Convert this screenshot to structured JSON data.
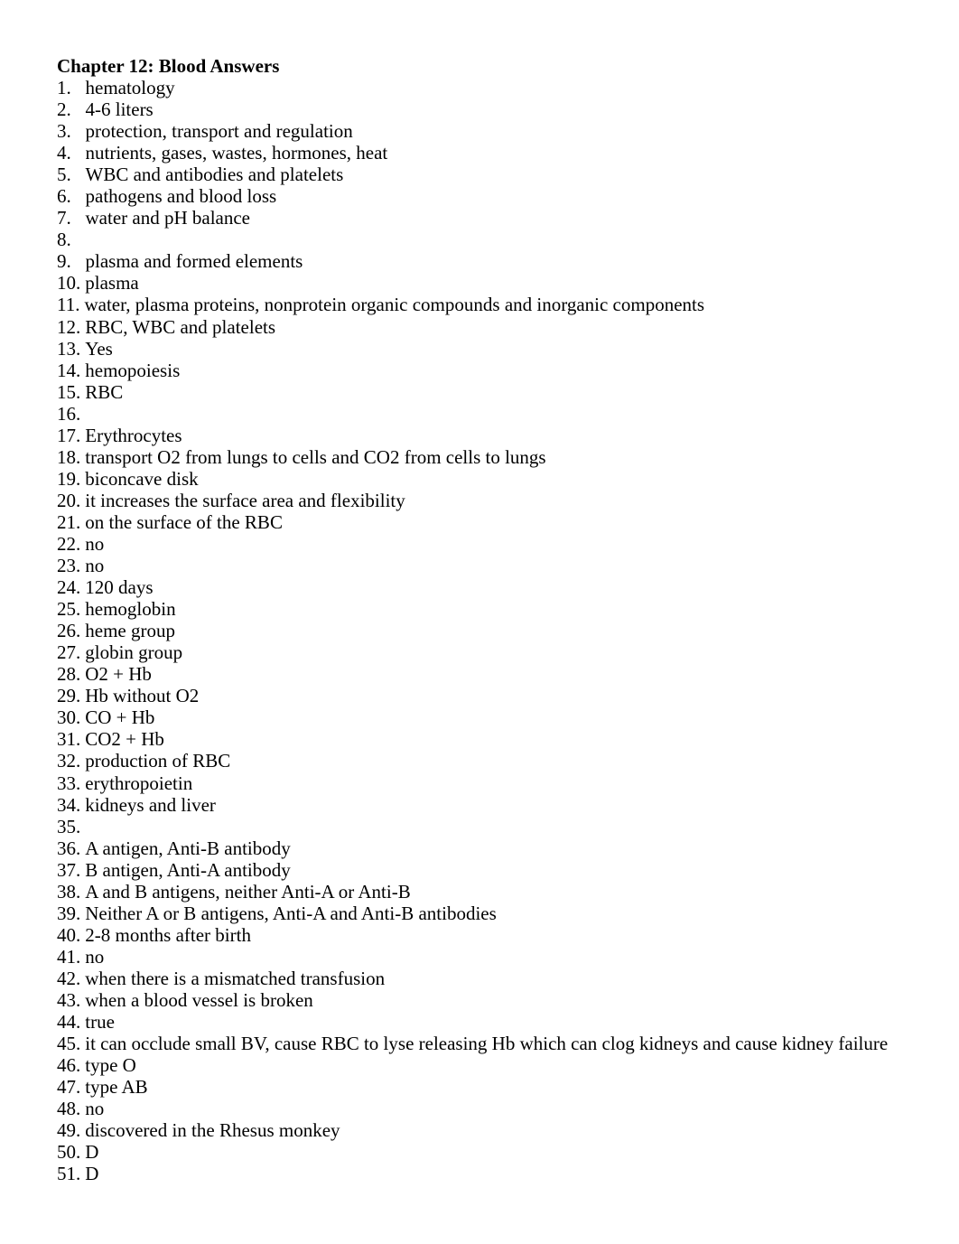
{
  "document": {
    "title": "Chapter 12: Blood Answers",
    "answers": [
      {
        "number": "1.",
        "text": "hematology"
      },
      {
        "number": "2.",
        "text": "4-6 liters"
      },
      {
        "number": "3.",
        "text": "protection, transport and regulation"
      },
      {
        "number": "4.",
        "text": "nutrients, gases, wastes, hormones, heat"
      },
      {
        "number": "5.",
        "text": "WBC and antibodies and platelets"
      },
      {
        "number": "6.",
        "text": "pathogens and blood loss"
      },
      {
        "number": "7.",
        "text": "water and pH balance"
      },
      {
        "number": "8.",
        "text": ""
      },
      {
        "number": "9.",
        "text": "plasma and formed elements"
      },
      {
        "number": "10.",
        "text": "plasma"
      },
      {
        "number": "11.",
        "text": "water, plasma proteins, nonprotein organic compounds and inorganic components"
      },
      {
        "number": "12.",
        "text": "RBC, WBC and platelets"
      },
      {
        "number": "13.",
        "text": "Yes"
      },
      {
        "number": "14.",
        "text": "hemopoiesis"
      },
      {
        "number": "15.",
        "text": "RBC"
      },
      {
        "number": "16.",
        "text": ""
      },
      {
        "number": "17.",
        "text": "Erythrocytes"
      },
      {
        "number": "18.",
        "text": "transport O2 from lungs to cells and CO2 from cells to lungs"
      },
      {
        "number": "19.",
        "text": "biconcave disk"
      },
      {
        "number": "20.",
        "text": "it increases the surface area and flexibility"
      },
      {
        "number": "21.",
        "text": "on the surface of the RBC"
      },
      {
        "number": "22.",
        "text": "no"
      },
      {
        "number": "23.",
        "text": "no"
      },
      {
        "number": "24.",
        "text": "120 days"
      },
      {
        "number": "25.",
        "text": "hemoglobin"
      },
      {
        "number": "26.",
        "text": "heme group"
      },
      {
        "number": "27.",
        "text": "globin group"
      },
      {
        "number": "28.",
        "text": "O2 + Hb"
      },
      {
        "number": "29.",
        "text": "Hb without O2"
      },
      {
        "number": "30.",
        "text": "CO + Hb"
      },
      {
        "number": "31.",
        "text": "CO2 + Hb"
      },
      {
        "number": "32.",
        "text": "production of RBC"
      },
      {
        "number": "33.",
        "text": "erythropoietin"
      },
      {
        "number": "34.",
        "text": "kidneys and liver"
      },
      {
        "number": "35.",
        "text": ""
      },
      {
        "number": "36.",
        "text": "A antigen, Anti-B antibody"
      },
      {
        "number": "37.",
        "text": "B antigen, Anti-A antibody"
      },
      {
        "number": "38.",
        "text": "A and B antigens, neither Anti-A or Anti-B"
      },
      {
        "number": "39.",
        "text": "Neither A or B antigens, Anti-A and Anti-B antibodies"
      },
      {
        "number": "40.",
        "text": "2-8 months after birth"
      },
      {
        "number": "41.",
        "text": "no"
      },
      {
        "number": "42.",
        "text": "when there is a mismatched transfusion"
      },
      {
        "number": "43.",
        "text": "when a blood vessel is broken"
      },
      {
        "number": "44.",
        "text": "true"
      },
      {
        "number": "45.",
        "text": "it can occlude small BV, cause RBC to lyse releasing Hb which can clog kidneys and cause kidney failure"
      },
      {
        "number": "46.",
        "text": "type O"
      },
      {
        "number": "47.",
        "text": "type AB"
      },
      {
        "number": "48.",
        "text": "no"
      },
      {
        "number": "49.",
        "text": "discovered in the Rhesus monkey"
      },
      {
        "number": "50.",
        "text": "D"
      },
      {
        "number": "51.",
        "text": "D"
      }
    ]
  }
}
